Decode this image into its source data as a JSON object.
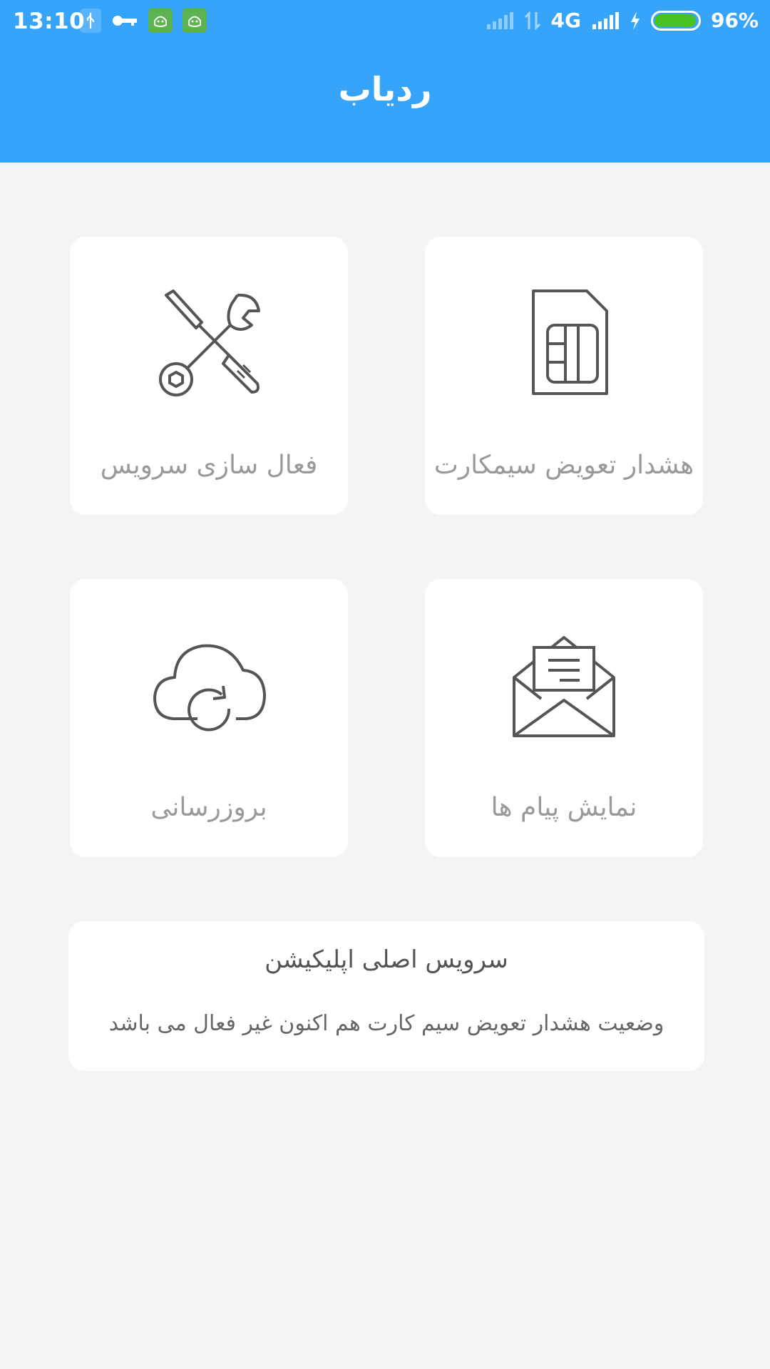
{
  "status_bar": {
    "time": "13:10",
    "network": "4G",
    "battery": "96%",
    "battery_level": 0.96,
    "icons": [
      "usb-icon",
      "key-icon",
      "android-icon",
      "android-icon",
      "signal-icon",
      "data-arrows-icon",
      "signal-icon",
      "charging-icon",
      "battery-icon"
    ]
  },
  "app_bar": {
    "title": "ردیاب"
  },
  "cards": [
    {
      "label": "هشدار تعویض سیمکارت",
      "icon": "sim-card-icon"
    },
    {
      "label": "فعال سازی سرویس",
      "icon": "tools-icon"
    },
    {
      "label": "نمایش پیام ها",
      "icon": "open-envelope-icon"
    },
    {
      "label": "بروزرسانی",
      "icon": "cloud-refresh-icon"
    }
  ],
  "service_panel": {
    "title": "سرویس اصلی اپلیکیشن",
    "status_text": "وضعیت هشدار تعویض سیم کارت هم اکنون غیر فعال می باشد"
  },
  "colors": {
    "primary": "#36a4fa",
    "background": "#f4f4f4",
    "card": "#ffffff",
    "label_text": "#9a9a9a",
    "icon_stroke": "#555555"
  }
}
